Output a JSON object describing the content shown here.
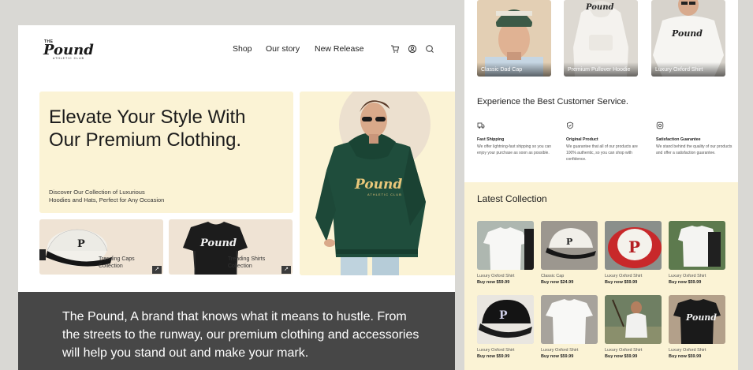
{
  "brand": {
    "the": "THE",
    "name": "Pound",
    "sub": "ATHLETIC CLUB"
  },
  "nav": {
    "items": [
      "Shop",
      "Our story",
      "New Release"
    ]
  },
  "hero": {
    "title_line1": "Elevate Your Style With",
    "title_line2": "Our Premium Clothing.",
    "sub_line1": "Discover Our Collection of Luxurious",
    "sub_line2": "Hoodies and Hats, Perfect for Any Occasion",
    "hoodie_logo": "Pound",
    "hoodie_sub": "ATHLETIC CLUB"
  },
  "tiles": [
    {
      "line1": "Trending Caps",
      "line2": "Collection"
    },
    {
      "line1": "Trending Shirts",
      "line2": "Collection"
    }
  ],
  "banner": "The Pound, A brand that knows what it means to hustle. From the streets to the runway, our premium clothing and accessories will help you stand out and make your mark.",
  "top_products": [
    "Classic Dad Cap",
    "Premium Pullover Hoodie",
    "Luxury Oxford Shirt"
  ],
  "service": {
    "title": "Experience the Best Customer Service.",
    "items": [
      {
        "name": "Fast Shipping",
        "desc": "We offer lightning-fast shipping so you can enjoy your purchase as soon as possible."
      },
      {
        "name": "Original Product",
        "desc": "We guarantee that all of our products are 100% authentic, so you can shop with confidence."
      },
      {
        "name": "Satisfaction Guarantee",
        "desc": "We stand behind the quality of our products and offer a satisfaction guarantee."
      }
    ]
  },
  "latest": {
    "title": "Latest Collection",
    "products": [
      {
        "name": "Luxury Oxford Shirt",
        "price": "Buy now $59.99"
      },
      {
        "name": "Classic Cap",
        "price": "Buy now $24.99"
      },
      {
        "name": "Luxury Oxford Shirt",
        "price": "Buy now $59.99"
      },
      {
        "name": "Luxury Oxford Shirt",
        "price": "Buy now $59.99"
      },
      {
        "name": "Luxury Oxford Shirt",
        "price": "Buy now $59.99"
      },
      {
        "name": "Luxury Oxford Shirt",
        "price": "Buy now $59.99"
      },
      {
        "name": "Luxury Oxford Shirt",
        "price": "Buy now $59.99"
      },
      {
        "name": "Luxury Oxford Shirt",
        "price": "Buy now $59.99"
      }
    ]
  },
  "colors": {
    "cream": "#fbf3d5",
    "hoodie": "#1f4d3c",
    "banner": "#474747",
    "beige": "#efe3d4"
  },
  "icons": [
    "cart-icon",
    "user-icon",
    "search-icon",
    "arrow-icon",
    "truck-icon",
    "shield-icon",
    "badge-icon"
  ]
}
